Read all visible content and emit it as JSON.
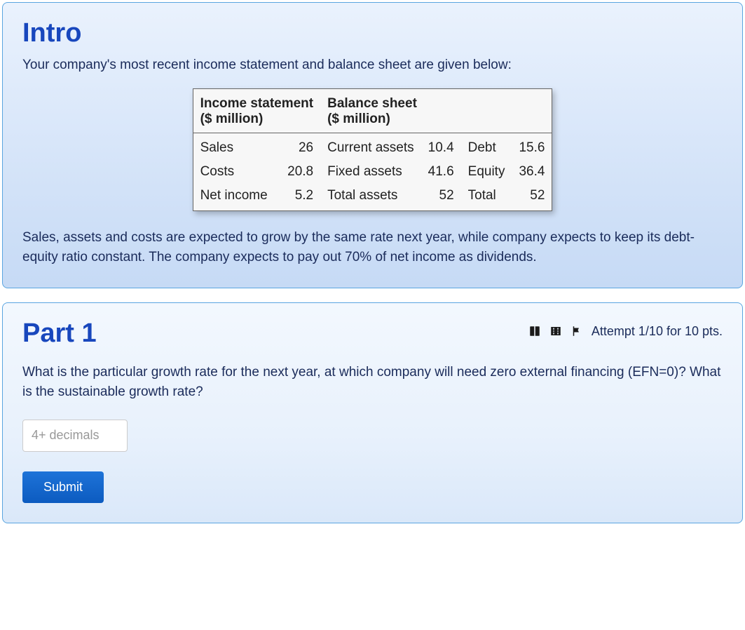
{
  "intro": {
    "title": "Intro",
    "lead": "Your company's most recent income statement and balance sheet are given below:",
    "followup": "Sales, assets and costs are expected to grow by the same rate next year, while company expects to keep its debt-equity ratio constant. The company expects to pay out 70% of net income as dividends."
  },
  "table": {
    "headers": {
      "income_line1": "Income statement",
      "income_line2": "($ million)",
      "balance_line1": "Balance sheet",
      "balance_line2": "($ million)"
    },
    "rows": [
      {
        "inc_label": "Sales",
        "inc_val": "26",
        "bal_a_label": "Current assets",
        "bal_a_val": "10.4",
        "bal_b_label": "Debt",
        "bal_b_val": "15.6"
      },
      {
        "inc_label": "Costs",
        "inc_val": "20.8",
        "bal_a_label": "Fixed assets",
        "bal_a_val": "41.6",
        "bal_b_label": "Equity",
        "bal_b_val": "36.4"
      },
      {
        "inc_label": "Net income",
        "inc_val": "5.2",
        "bal_a_label": "Total assets",
        "bal_a_val": "52",
        "bal_b_label": "Total",
        "bal_b_val": "52"
      }
    ]
  },
  "part1": {
    "title": "Part 1",
    "attempt_text": "Attempt 1/10 for 10 pts.",
    "question": "What is the particular growth rate for the next year, at which company will need zero external financing (EFN=0)? What is the sustainable growth rate?",
    "input_placeholder": "4+ decimals",
    "submit_label": "Submit"
  }
}
